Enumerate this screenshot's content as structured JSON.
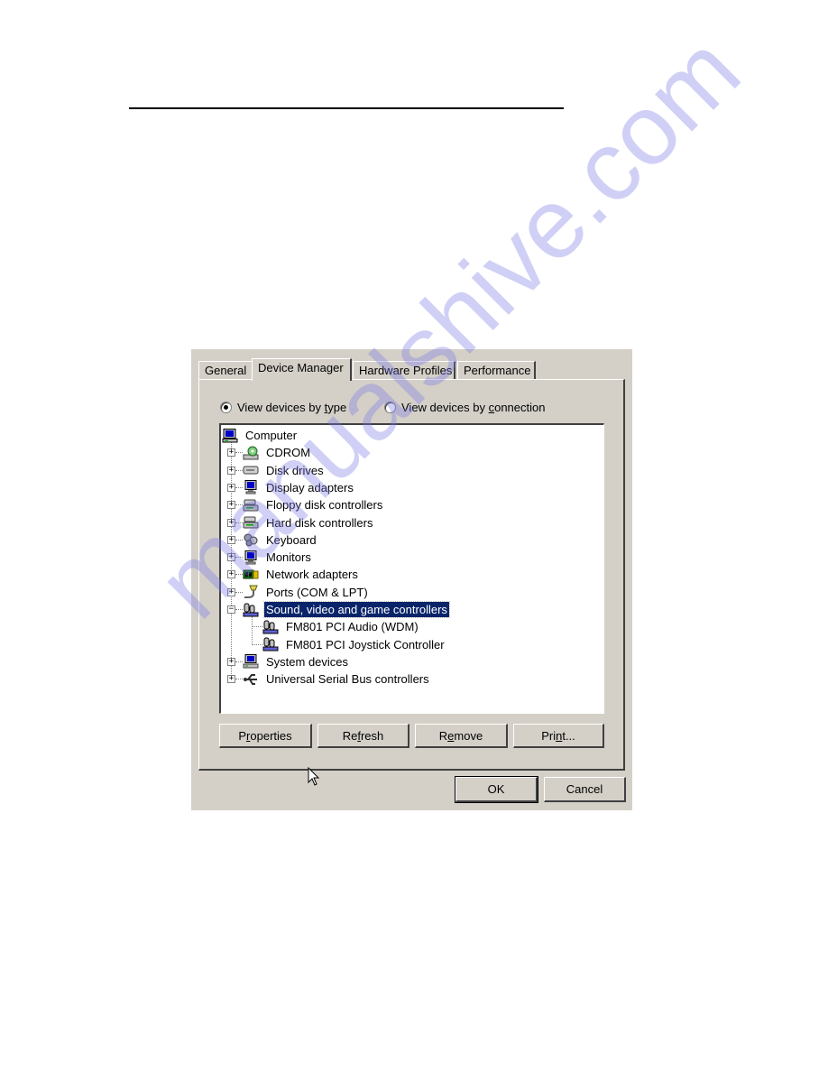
{
  "tabs": [
    {
      "label": "General",
      "active": false
    },
    {
      "label": "Device Manager",
      "active": true
    },
    {
      "label": "Hardware Profiles",
      "active": false
    },
    {
      "label": "Performance",
      "active": false
    }
  ],
  "view_options": {
    "by_type": {
      "pre": "View devices by ",
      "accel": "t",
      "post": "ype",
      "checked": true
    },
    "by_connection": {
      "pre": "View devices by ",
      "accel": "c",
      "post": "onnection",
      "checked": false
    }
  },
  "tree": {
    "root": {
      "label": "Computer",
      "icon": "computer-icon"
    },
    "items": [
      {
        "label": "CDROM",
        "icon": "cdrom-icon",
        "expanded": false
      },
      {
        "label": "Disk drives",
        "icon": "disk-drive-icon",
        "expanded": false
      },
      {
        "label": "Display adapters",
        "icon": "display-adapter-icon",
        "expanded": false
      },
      {
        "label": "Floppy disk controllers",
        "icon": "floppy-controller-icon",
        "expanded": false
      },
      {
        "label": "Hard disk controllers",
        "icon": "hard-disk-controller-icon",
        "expanded": false
      },
      {
        "label": "Keyboard",
        "icon": "keyboard-icon",
        "expanded": false
      },
      {
        "label": "Monitors",
        "icon": "monitor-icon",
        "expanded": false
      },
      {
        "label": "Network adapters",
        "icon": "network-adapter-icon",
        "expanded": false
      },
      {
        "label": "Ports (COM & LPT)",
        "icon": "port-icon",
        "expanded": false
      },
      {
        "label": "Sound, video and game controllers",
        "icon": "sound-controller-icon",
        "expanded": true,
        "selected": true,
        "children": [
          {
            "label": "FM801 PCI Audio (WDM)",
            "icon": "sound-controller-icon"
          },
          {
            "label": "FM801 PCI Joystick Controller",
            "icon": "sound-controller-icon"
          }
        ]
      },
      {
        "label": "System devices",
        "icon": "system-devices-icon",
        "expanded": false
      },
      {
        "label": "Universal Serial Bus controllers",
        "icon": "usb-icon",
        "expanded": false
      }
    ]
  },
  "buttons": {
    "properties": {
      "pre": "P",
      "accel": "r",
      "post": "operties"
    },
    "refresh": {
      "pre": "Re",
      "accel": "f",
      "post": "resh"
    },
    "remove": {
      "pre": "R",
      "accel": "e",
      "post": "move"
    },
    "print": {
      "pre": "Pri",
      "accel": "n",
      "post": "t..."
    },
    "ok": "OK",
    "cancel": "Cancel"
  },
  "watermark": "manualshive.com",
  "colors": {
    "dialog_bg": "#d4d0c8",
    "selection_bg": "#0a246a",
    "selection_fg": "#ffffff"
  }
}
